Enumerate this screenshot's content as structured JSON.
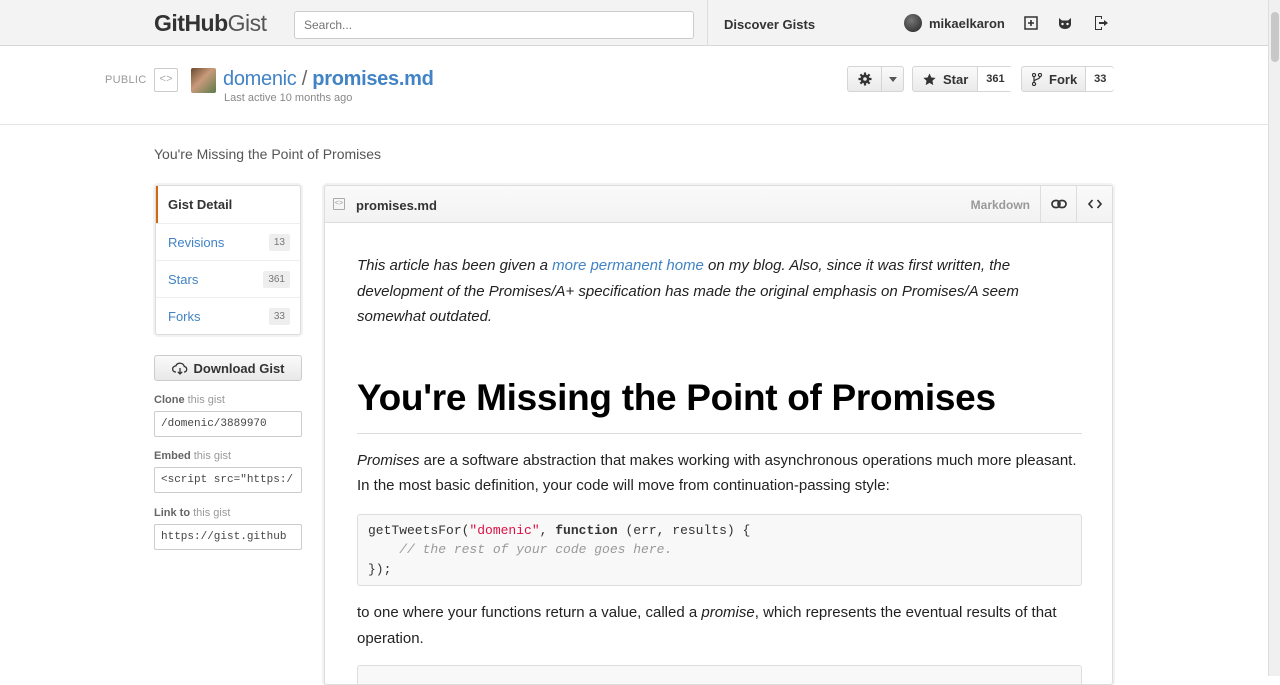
{
  "header": {
    "logo_bold": "GitHub",
    "logo_light": "Gist",
    "search_placeholder": "Search...",
    "discover": "Discover Gists",
    "username": "mikaelkaron",
    "icons": [
      "new-gist-icon",
      "octocat-icon",
      "sign-out-icon"
    ]
  },
  "gist": {
    "visibility": "PUBLIC",
    "owner": "domenic",
    "separator": "/",
    "filename": "promises.md",
    "last_active": "Last active 10 months ago",
    "description": "You're Missing the Point of Promises",
    "star_label": "Star",
    "star_count": "361",
    "fork_label": "Fork",
    "fork_count": "33"
  },
  "sidebar": {
    "items": [
      {
        "label": "Gist Detail",
        "count": ""
      },
      {
        "label": "Revisions",
        "count": "13"
      },
      {
        "label": "Stars",
        "count": "361"
      },
      {
        "label": "Forks",
        "count": "33"
      }
    ],
    "download": "Download Gist",
    "clone_label_bold": "Clone",
    "clone_label_rest": " this gist",
    "clone_value": "/domenic/3889970",
    "embed_label_bold": "Embed",
    "embed_label_rest": " this gist",
    "embed_value": "<script src=\"https:/",
    "link_label_bold": "Link to",
    "link_label_rest": " this gist",
    "link_value": "https://gist.github"
  },
  "file": {
    "name": "promises.md",
    "type": "Markdown",
    "intro_1": "This article has been given a ",
    "intro_link": "more permanent home",
    "intro_2": " on my blog. Also, since it was first written, the development of the Promises/A+ specification has made the original emphasis on Promises/A seem somewhat outdated.",
    "heading": "You're Missing the Point of Promises",
    "para1_em": "Promises",
    "para1_rest": " are a software abstraction that makes working with asynchronous operations much more pleasant. In the most basic definition, your code will move from continuation-passing style:",
    "code_fn": "getTweetsFor(",
    "code_str": "\"domenic\"",
    "code_comma": ", ",
    "code_kw": "function",
    "code_args": " (err, results) {",
    "code_comment": "    // the rest of your code goes here.",
    "code_end": "});",
    "para2_a": "to one where your functions return a value, called a ",
    "para2_em": "promise",
    "para2_b": ", which represents the eventual results of that operation."
  }
}
